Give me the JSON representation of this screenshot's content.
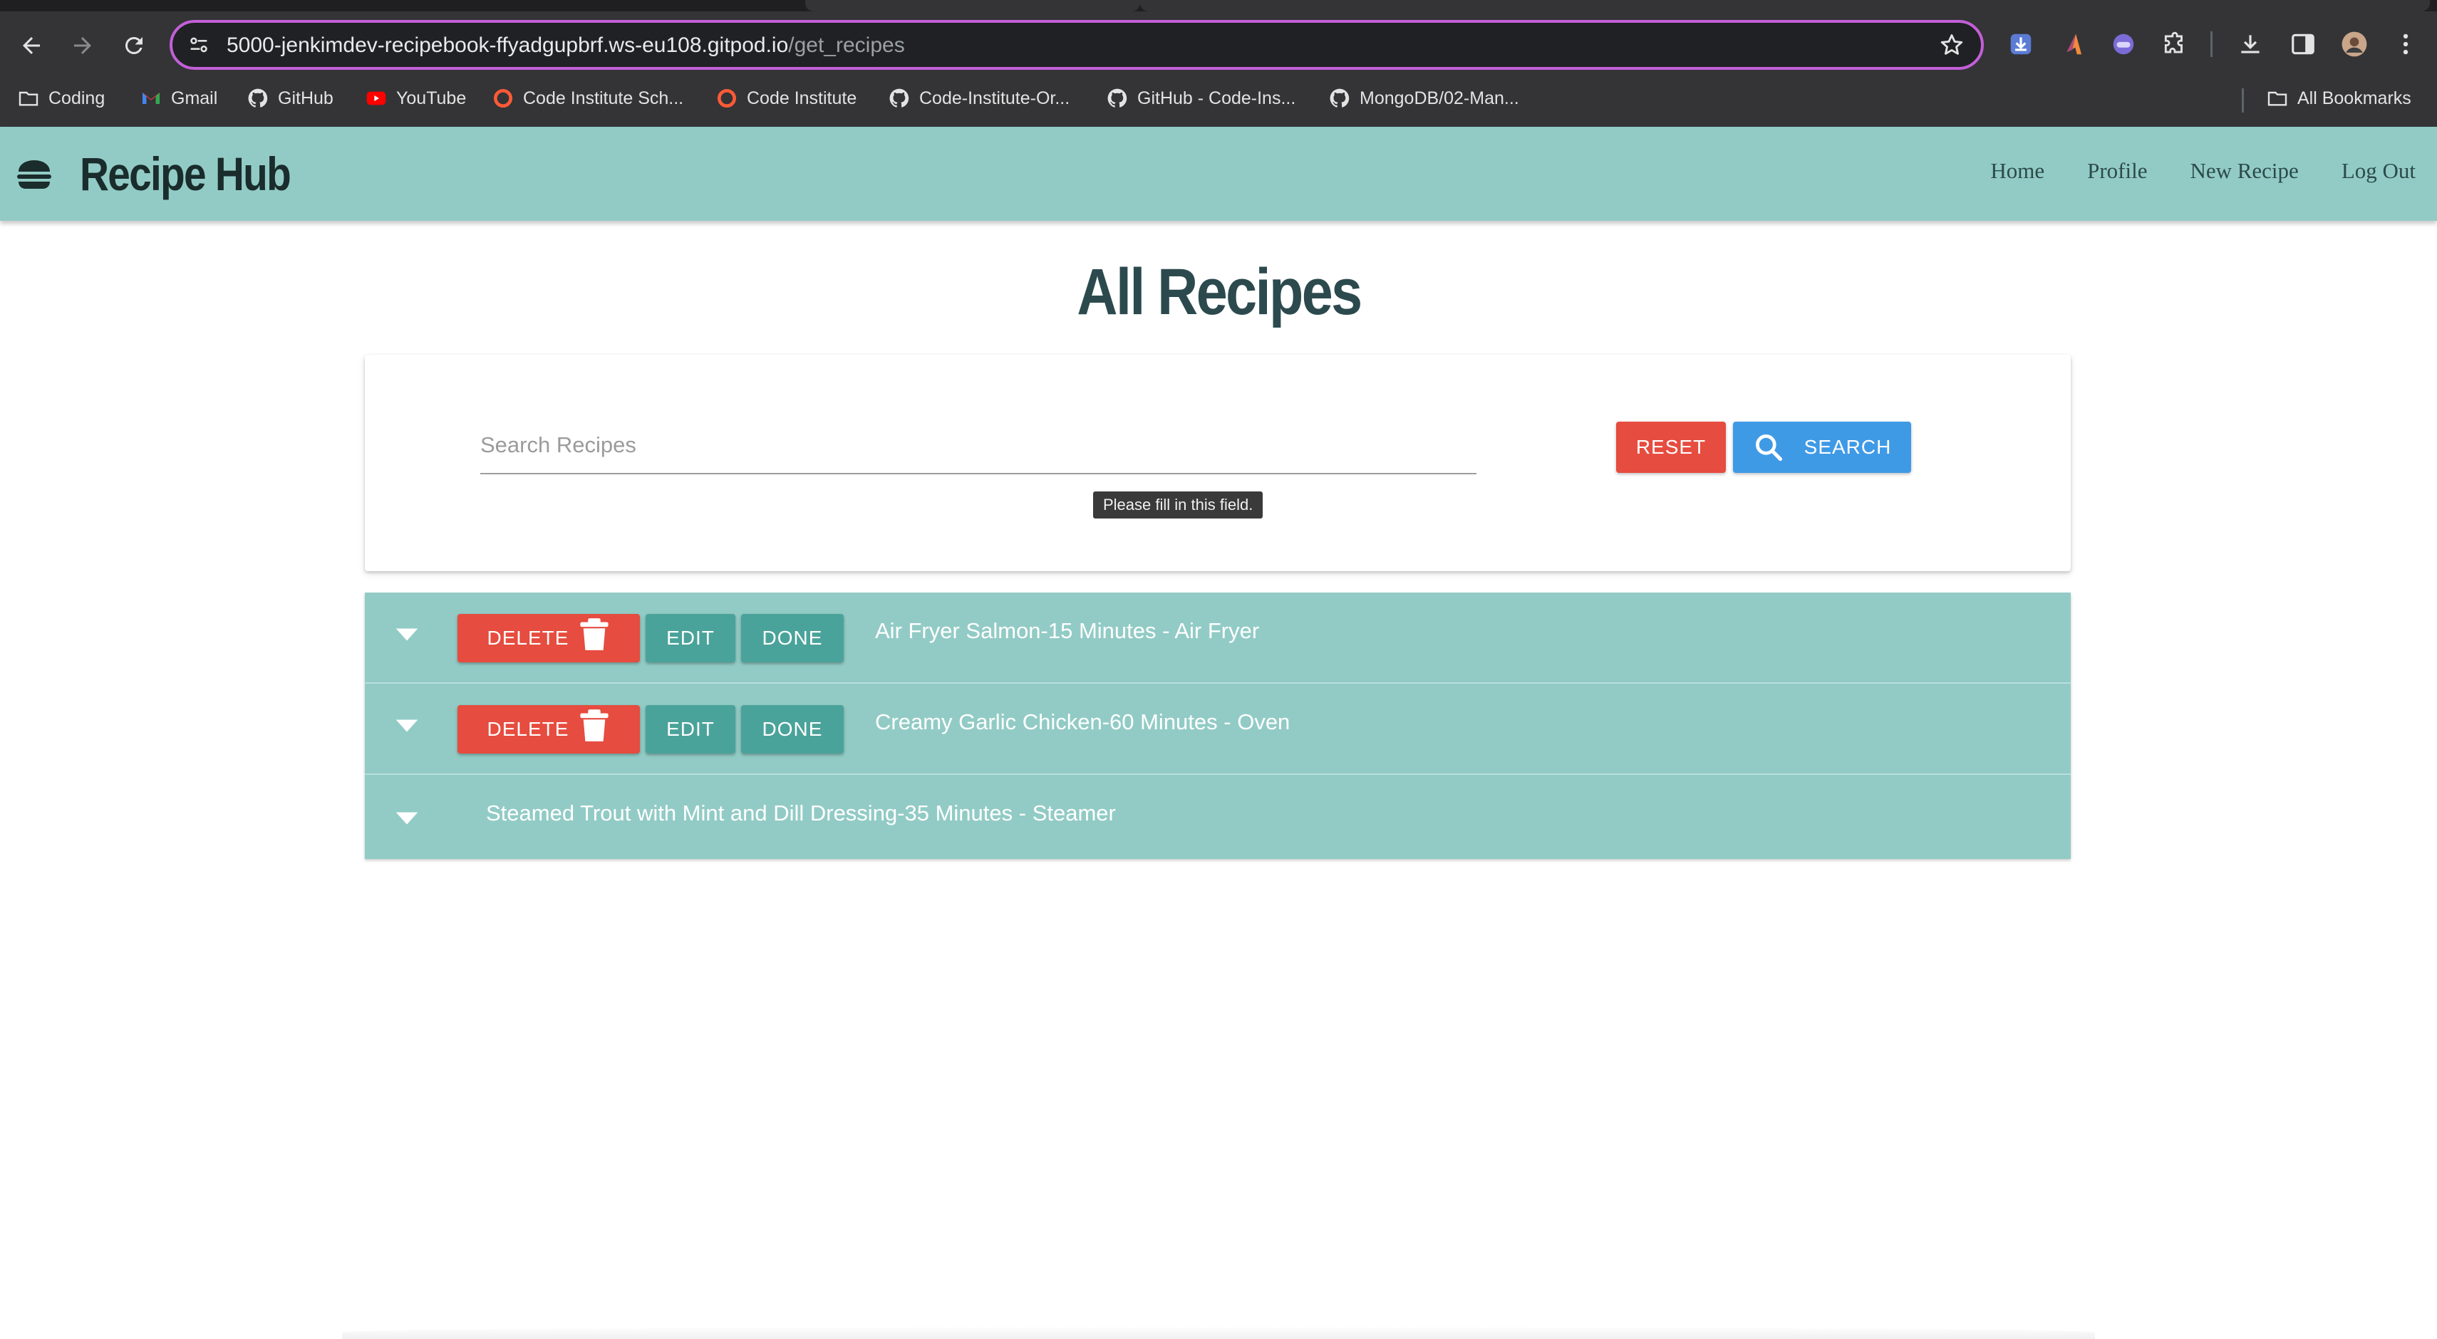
{
  "browser": {
    "url_host": "5000-jenkimdev-recipebook-ffyadgupbrf.ws-eu108.gitpod.io",
    "url_path": "/get_recipes",
    "bookmarks": [
      {
        "label": "Coding",
        "icon": "folder-icon"
      },
      {
        "label": "Gmail",
        "icon": "gmail-icon"
      },
      {
        "label": "GitHub",
        "icon": "github-icon"
      },
      {
        "label": "YouTube",
        "icon": "youtube-icon"
      },
      {
        "label": "Code Institute Sch...",
        "icon": "code-institute-icon"
      },
      {
        "label": "Code Institute",
        "icon": "code-institute-icon"
      },
      {
        "label": "Code-Institute-Or...",
        "icon": "github-icon"
      },
      {
        "label": "GitHub - Code-Ins...",
        "icon": "github-icon"
      },
      {
        "label": "MongoDB/02-Man...",
        "icon": "github-icon"
      }
    ],
    "all_bookmarks": "All Bookmarks",
    "accent_color": "#c35fd8"
  },
  "app": {
    "brand": "Recipe Hub",
    "nav_links": [
      "Home",
      "Profile",
      "New Recipe",
      "Log Out"
    ],
    "nav_color": "#92cbc5"
  },
  "page": {
    "title": "All Recipes"
  },
  "search": {
    "placeholder": "Search Recipes",
    "value": "",
    "tooltip": "Please fill in this field.",
    "reset_label": "RESET",
    "search_label": "SEARCH"
  },
  "recipes": [
    {
      "title": "Air Fryer Salmon-15 Minutes - Air Fryer",
      "delete_label": "DELETE",
      "edit_label": "EDIT",
      "done_label": "DONE",
      "has_actions": true
    },
    {
      "title": "Creamy Garlic Chicken-60 Minutes - Oven",
      "delete_label": "DELETE",
      "edit_label": "EDIT",
      "done_label": "DONE",
      "has_actions": true
    },
    {
      "title": "Steamed Trout with Mint and Dill Dressing-35 Minutes - Steamer",
      "has_actions": false
    }
  ],
  "colors": {
    "danger": "#e64c3f",
    "primary": "#3f9ae6",
    "teal_button": "#4aa39a",
    "title_text": "#2c4a4e"
  }
}
